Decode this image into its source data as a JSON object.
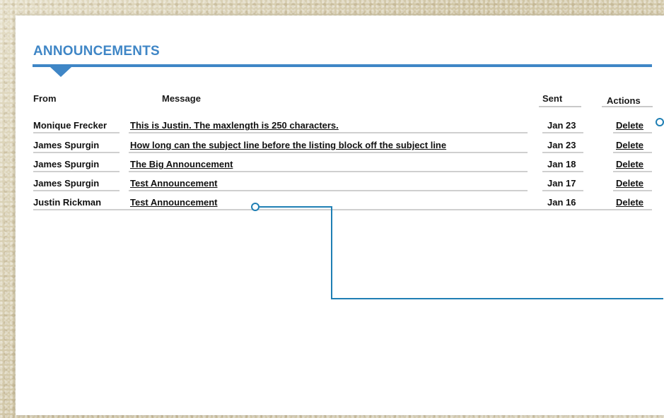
{
  "section": {
    "title": "ANNOUNCEMENTS"
  },
  "table": {
    "headers": {
      "from": "From",
      "message": "Message",
      "sent": "Sent",
      "actions": "Actions"
    },
    "rows": [
      {
        "from": "Monique Frecker",
        "message": "This is Justin. The maxlength is 250 characters.",
        "sent": "Jan 23",
        "action": "Delete"
      },
      {
        "from": "James Spurgin",
        "message": "How long can the subject line before the listing block off the subject line",
        "sent": "Jan 23",
        "action": "Delete"
      },
      {
        "from": "James Spurgin",
        "message": "The Big Announcement",
        "sent": "Jan 18",
        "action": "Delete"
      },
      {
        "from": "James Spurgin",
        "message": "Test Announcement",
        "sent": "Jan 17",
        "action": "Delete"
      },
      {
        "from": "Justin Rickman",
        "message": "Test Announcement",
        "sent": "Jan 16",
        "action": "Delete"
      }
    ]
  },
  "colors": {
    "accent": "#3f86c6",
    "callout": "#1f7fb4"
  }
}
